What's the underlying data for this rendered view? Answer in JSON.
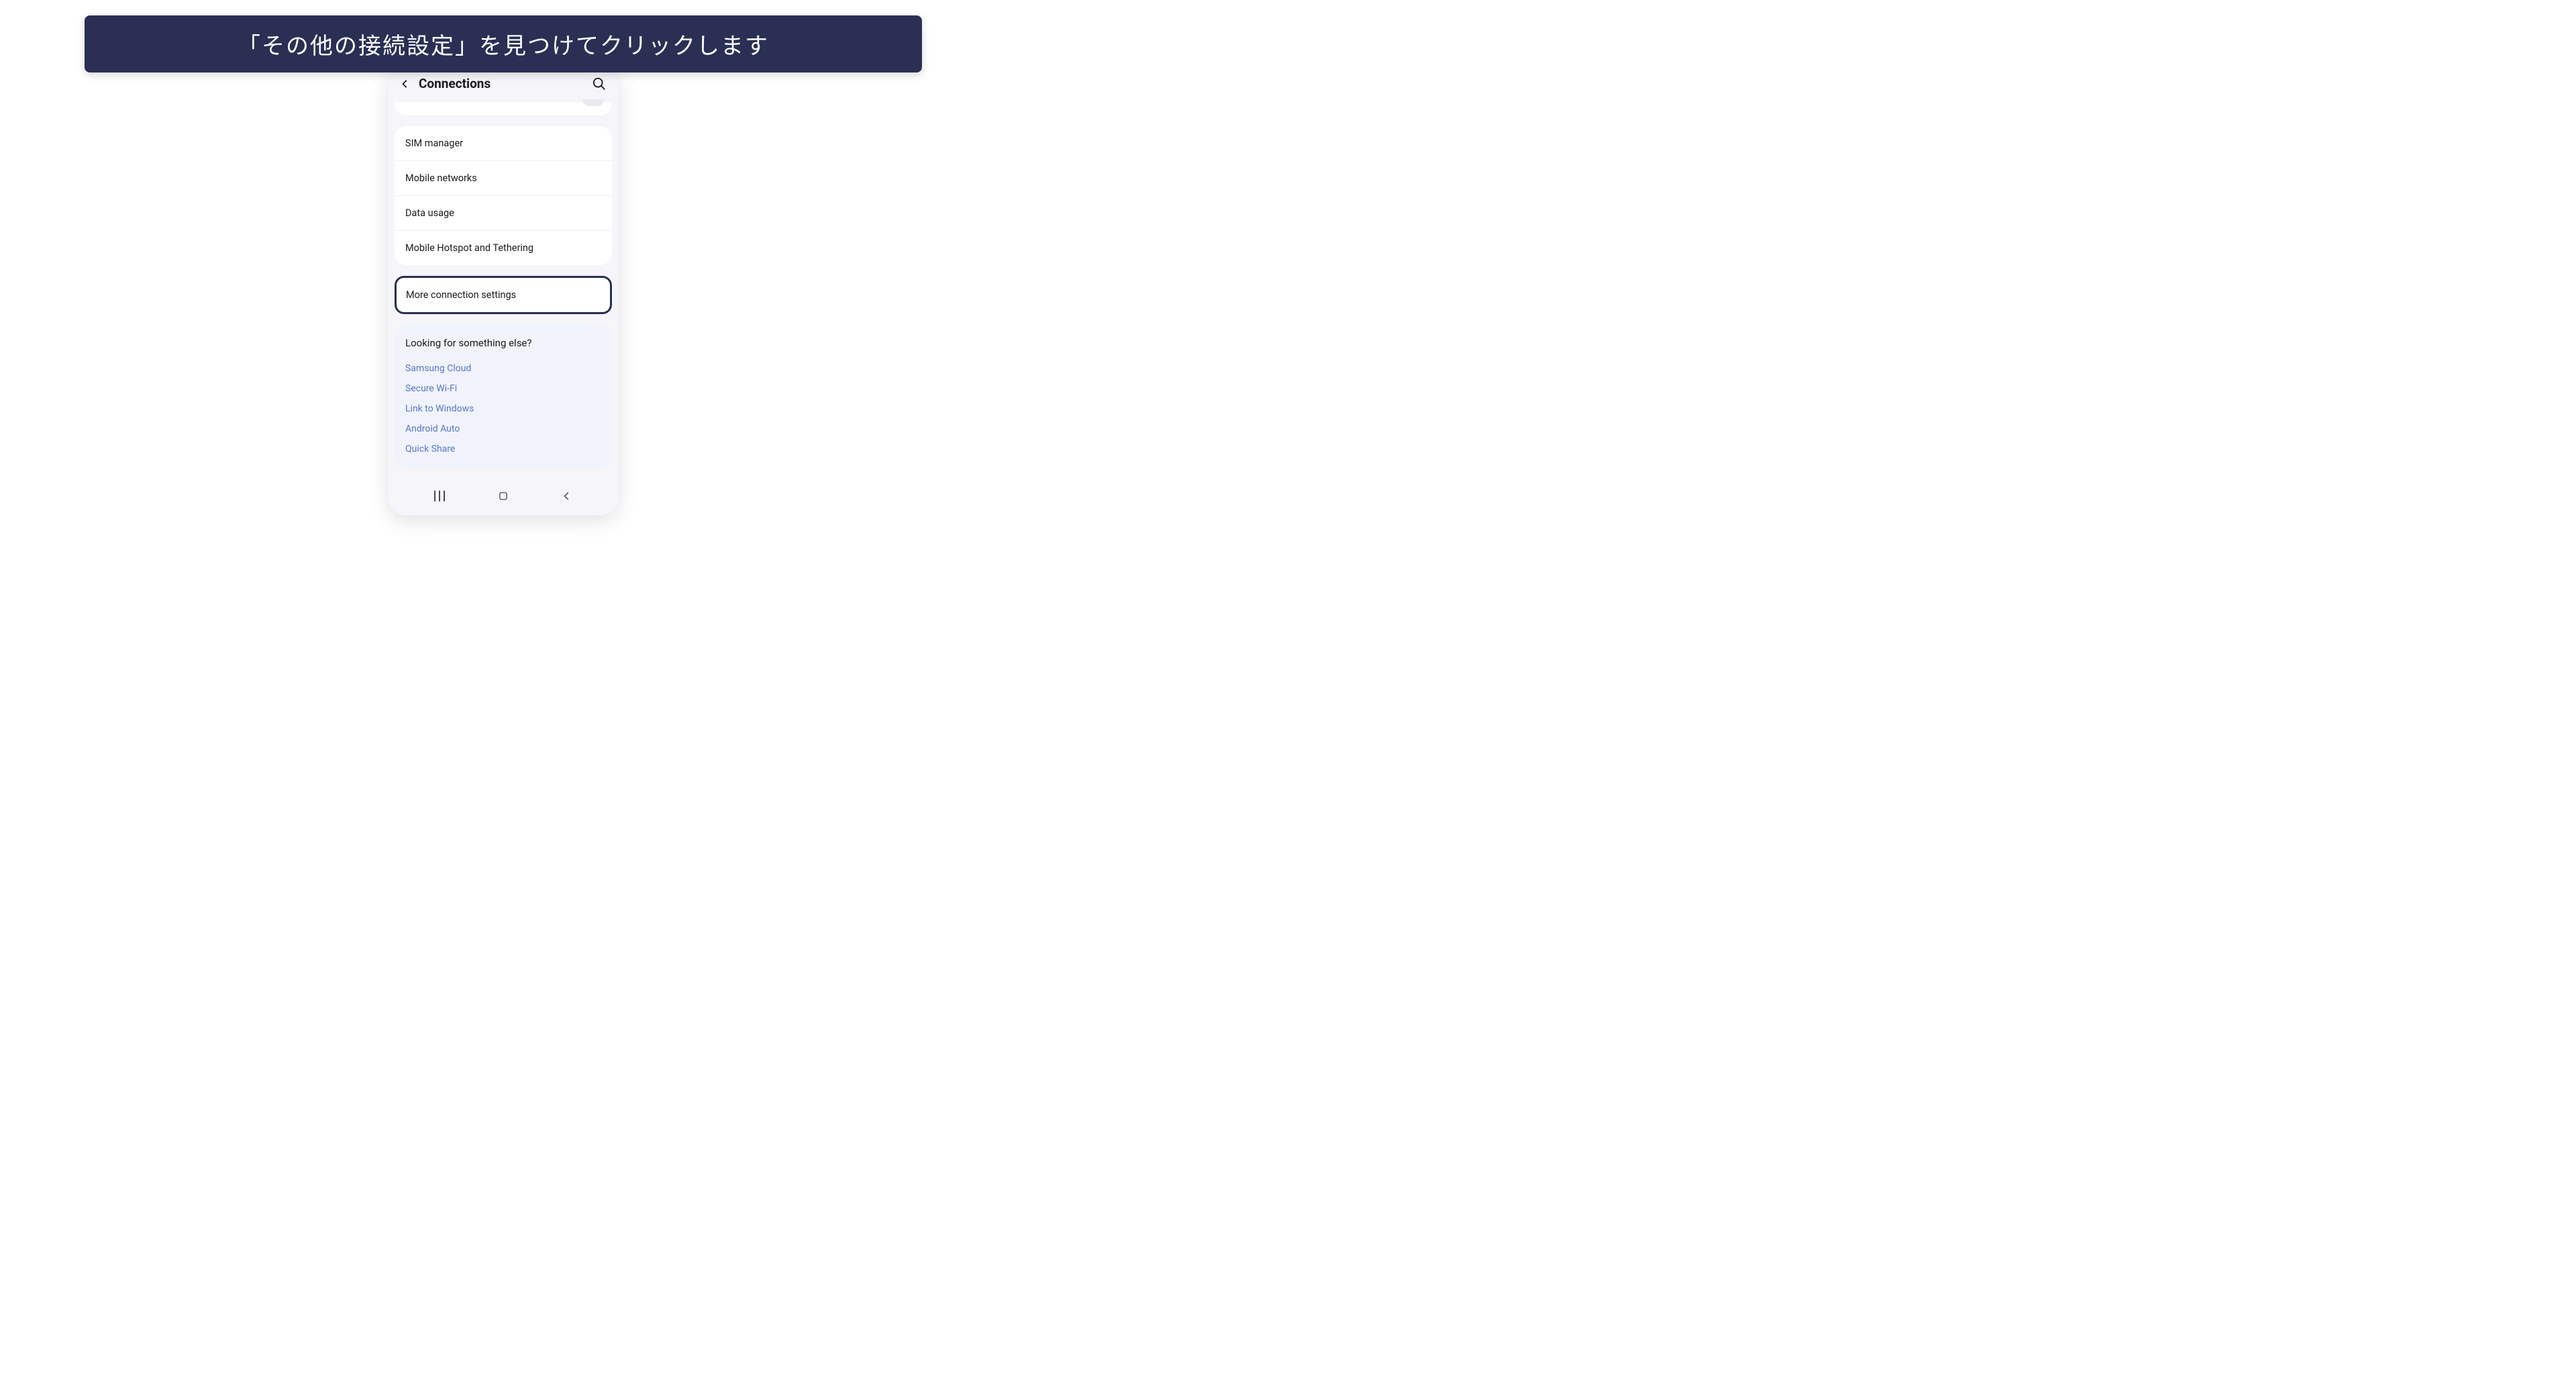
{
  "instruction": {
    "text": "「その他の接続設定」を見つけてクリックします"
  },
  "header": {
    "title": "Connections"
  },
  "settings": {
    "items": [
      {
        "label": "SIM manager"
      },
      {
        "label": "Mobile networks"
      },
      {
        "label": "Data usage"
      },
      {
        "label": "Mobile Hotspot and Tethering"
      }
    ]
  },
  "highlighted": {
    "label": "More connection settings"
  },
  "suggestions": {
    "title": "Looking for something else?",
    "links": [
      {
        "label": "Samsung Cloud"
      },
      {
        "label": "Secure Wi-Fi"
      },
      {
        "label": "Link to Windows"
      },
      {
        "label": "Android Auto"
      },
      {
        "label": "Quick Share"
      }
    ]
  }
}
